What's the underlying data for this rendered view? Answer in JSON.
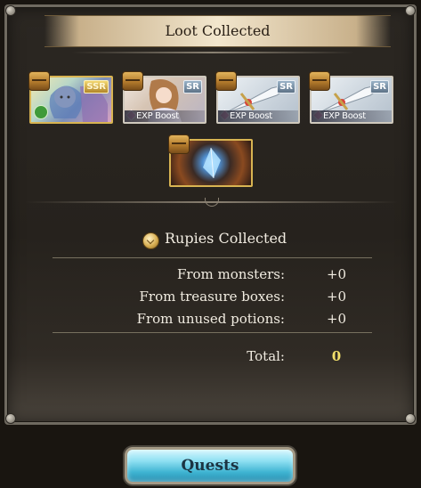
{
  "dialog": {
    "title": "Loot Collected"
  },
  "loot": [
    {
      "name": "ssr-character-item",
      "rarity": "SSR",
      "boost": ""
    },
    {
      "name": "sr-character-exp-boost",
      "rarity": "SR",
      "boost": "EXP Boost"
    },
    {
      "name": "sr-weapon-exp-boost-1",
      "rarity": "SR",
      "boost": "EXP Boost"
    },
    {
      "name": "sr-weapon-exp-boost-2",
      "rarity": "SR",
      "boost": "EXP Boost"
    },
    {
      "name": "summon-crystal-item",
      "rarity": "",
      "boost": ""
    }
  ],
  "rupies": {
    "heading": "Rupies Collected",
    "rows": [
      {
        "label": "From monsters:",
        "value": "+0"
      },
      {
        "label": "From treasure boxes:",
        "value": "+0"
      },
      {
        "label": "From unused potions:",
        "value": "+0"
      }
    ],
    "total_label": "Total:",
    "total_value": "0"
  },
  "colors": {
    "total_value": "#f3e06a",
    "quests_button": "#5ccbe6"
  },
  "actions": {
    "quests_label": "Quests"
  }
}
